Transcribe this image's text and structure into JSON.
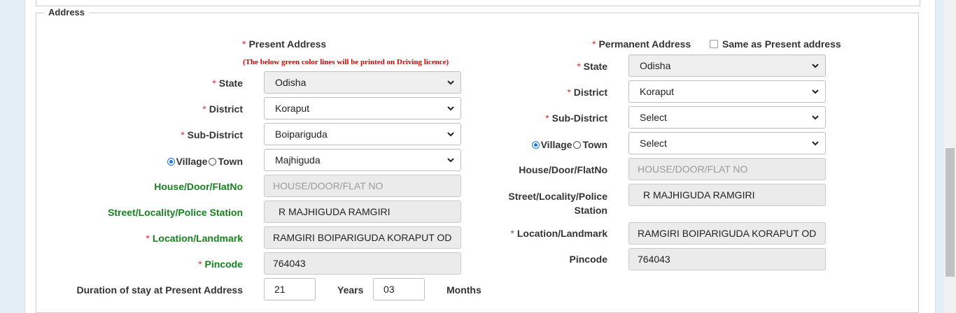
{
  "section": {
    "legend": "Address"
  },
  "present": {
    "heading": "Present Address",
    "note": "(The below green color lines will be printed on Driving licence)",
    "state": {
      "label": "State",
      "value": "Odisha"
    },
    "district": {
      "label": "District",
      "value": "Koraput"
    },
    "sub_district": {
      "label": "Sub-District",
      "value": "Boipariguda"
    },
    "village_label": "Village",
    "town_label": "Town",
    "village_value": "Majhiguda",
    "house": {
      "label": "House/Door/FlatNo",
      "placeholder": "HOUSE/DOOR/FLAT NO"
    },
    "street": {
      "label": "Street/Locality/Police Station",
      "value": "R MAJHIGUDA RAMGIRI"
    },
    "landmark": {
      "label": "Location/Landmark",
      "value": "RAMGIRI BOIPARIGUDA KORAPUT OD"
    },
    "pincode": {
      "label": "Pincode",
      "value": "764043"
    },
    "duration": {
      "label": "Duration of stay at Present Address",
      "years_value": "21",
      "years_label": "Years",
      "months_value": "03",
      "months_label": "Months"
    }
  },
  "permanent": {
    "heading": "Permanent Address",
    "same_as_label": "Same as Present address",
    "state": {
      "label": "State",
      "value": "Odisha"
    },
    "district": {
      "label": "District",
      "value": "Koraput"
    },
    "sub_district": {
      "label": "Sub-District",
      "value": "Select"
    },
    "village_label": "Village",
    "town_label": "Town",
    "village_value": "Select",
    "house": {
      "label": "House/Door/FlatNo",
      "placeholder": "HOUSE/DOOR/FLAT NO"
    },
    "street": {
      "label_line1": "Street/Locality/Police",
      "label_line2": "Station",
      "value": "R MAJHIGUDA RAMGIRI"
    },
    "landmark": {
      "label": "Location/Landmark",
      "value": "RAMGIRI BOIPARIGUDA KORAPUT OD"
    },
    "pincode": {
      "label": "Pincode",
      "value": "764043"
    }
  },
  "required_mark": "*"
}
